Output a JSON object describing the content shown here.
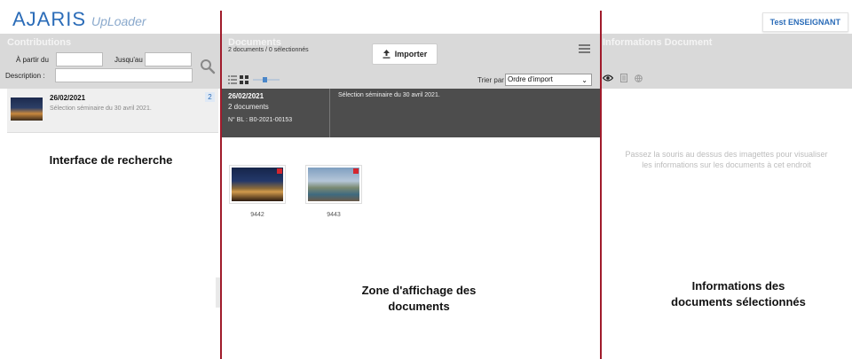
{
  "app": {
    "logo_main": "AJARIS",
    "logo_sub": "UpLoader",
    "user_label": "Test ENSEIGNANT"
  },
  "contributions": {
    "title": "Contributions",
    "from_label": "À partir du",
    "to_label": "Jusqu'au",
    "description_label": "Description :",
    "items": [
      {
        "date": "26/02/2021",
        "description": "Sélection séminaire du 30 avril 2021.",
        "count": "2"
      }
    ]
  },
  "documents": {
    "title": "Documents",
    "selection_status": "2 documents / 0 sélectionnés",
    "import_label": "Importer",
    "sort_label": "Trier par",
    "sort_value": "Ordre d'import",
    "group": {
      "date": "26/02/2021",
      "doc_count": "2 documents",
      "bl_number": "N° BL : B0-2021-00153",
      "description": "Sélection séminaire du 30 avril 2021."
    },
    "items": [
      {
        "id": "9442"
      },
      {
        "id": "9443"
      }
    ]
  },
  "info": {
    "title": "Informations Document",
    "hint_line1": "Passez la souris au dessus des imagettes pour visualiser",
    "hint_line2": "les informations sur les documents à cet endroit"
  },
  "annotations": {
    "search": "Interface de recherche",
    "display_line1": "Zone d'affichage des",
    "display_line2": "documents",
    "info_line1": "Informations des",
    "info_line2": "documents sélectionnés"
  },
  "colors": {
    "brand": "#2b6cb8",
    "panel_header": "#d9d9d9",
    "dark_row": "#4d4d4d",
    "separator": "#a01b2b"
  },
  "icons": [
    "search-icon",
    "upload-icon",
    "hamburger-menu-icon",
    "list-view-icon",
    "grid-view-icon",
    "zoom-slider",
    "eye-icon",
    "document-icon",
    "globe-icon"
  ]
}
